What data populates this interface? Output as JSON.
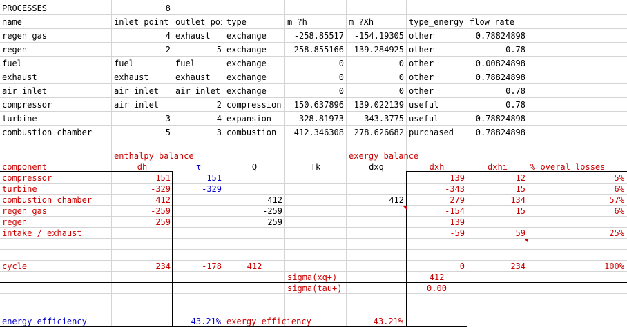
{
  "processes_label": "PROCESSES",
  "processes_count": "8",
  "process_headers": [
    "name",
    "inlet point",
    "outlet point",
    "type",
    "m ?h",
    "m ?Xh",
    "type_energy",
    "flow rate"
  ],
  "processes": [
    {
      "name": "regen gas",
      "inlet": "4",
      "outlet": "exhaust",
      "type": "exchange",
      "mh": "-258.85517",
      "mxh": "-154.19305",
      "energy": "other",
      "flow": "0.78824898"
    },
    {
      "name": "regen",
      "inlet": "2",
      "outlet": "5",
      "type": "exchange",
      "mh": "258.855166",
      "mxh": "139.284925",
      "energy": "other",
      "flow": "0.78"
    },
    {
      "name": "fuel",
      "inlet": "fuel",
      "outlet": "fuel",
      "type": "exchange",
      "mh": "0",
      "mxh": "0",
      "energy": "other",
      "flow": "0.00824898"
    },
    {
      "name": "exhaust",
      "inlet": "exhaust",
      "outlet": "exhaust",
      "type": "exchange",
      "mh": "0",
      "mxh": "0",
      "energy": "other",
      "flow": "0.78824898"
    },
    {
      "name": "air inlet",
      "inlet": "air inlet",
      "outlet": "air inlet",
      "type": "exchange",
      "mh": "0",
      "mxh": "0",
      "energy": "other",
      "flow": "0.78"
    },
    {
      "name": "compressor",
      "inlet": "air inlet",
      "outlet": "2",
      "type": "compression",
      "mh": "150.637896",
      "mxh": "139.022139",
      "energy": "useful",
      "flow": "0.78"
    },
    {
      "name": "turbine",
      "inlet": "3",
      "outlet": "4",
      "type": "expansion",
      "mh": "-328.81973",
      "mxh": "-343.3775",
      "energy": "useful",
      "flow": "0.78824898"
    },
    {
      "name": "combustion chamber",
      "inlet": "5",
      "outlet": "3",
      "type": "combustion",
      "mh": "412.346308",
      "mxh": "278.626682",
      "energy": "purchased",
      "flow": "0.78824898"
    }
  ],
  "enthalpy_title": "enthalpy balance",
  "exergy_title": "exergy balance",
  "balance_headers": [
    "component",
    "dh",
    "τ",
    "Q",
    "Tk",
    "dxq",
    "dxh",
    "dxhi",
    "% overal losses"
  ],
  "balance_rows": [
    {
      "component": "compressor",
      "dh": "151",
      "tau": "151",
      "q": "",
      "tk": "",
      "dxq": "",
      "dxh": "139",
      "dxhi": "12",
      "loss": "5%"
    },
    {
      "component": "turbine",
      "dh": "-329",
      "tau": "-329",
      "q": "",
      "tk": "",
      "dxq": "",
      "dxh": "-343",
      "dxhi": "15",
      "loss": "6%"
    },
    {
      "component": "combustion chamber",
      "dh": "412",
      "tau": "",
      "q": "412",
      "tk": "",
      "dxq": "412",
      "dxh": "279",
      "dxhi": "134",
      "loss": "57%"
    },
    {
      "component": "regen gas",
      "dh": "-259",
      "tau": "",
      "q": "-259",
      "tk": "",
      "dxq": "",
      "dxh": "-154",
      "dxhi": "15",
      "loss": "6%"
    },
    {
      "component": "regen",
      "dh": "259",
      "tau": "",
      "q": "259",
      "tk": "",
      "dxq": "",
      "dxh": "139",
      "dxhi": "",
      "loss": ""
    },
    {
      "component": "intake / exhaust",
      "dh": "",
      "tau": "",
      "q": "",
      "tk": "",
      "dxq": "",
      "dxh": "-59",
      "dxhi": "59",
      "loss": "25%"
    }
  ],
  "cycle": {
    "label": "cycle",
    "dh": "234",
    "tau": "-178",
    "q": "412",
    "dxh": "0",
    "dxhi": "234",
    "loss": "100%"
  },
  "sigma_xq_label": "sigma(xq+)",
  "sigma_xq_value": "412",
  "sigma_tau_label": "sigma(tau+)",
  "sigma_tau_value": "0.00",
  "energy_eff_label": "energy efficiency",
  "energy_eff_value": "43.21%",
  "exergy_eff_label": "exergy efficiency",
  "exergy_eff_value": "43.21%"
}
